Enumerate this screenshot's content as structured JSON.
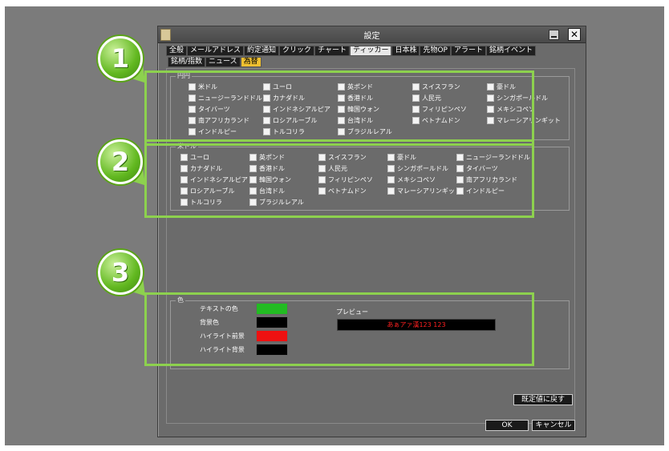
{
  "window": {
    "title": "設定"
  },
  "tabs_main": [
    "全般",
    "メールアドレス",
    "約定通知",
    "クリック",
    "チャート",
    "ティッカー",
    "日本株",
    "先物OP",
    "アラート",
    "銘柄イベント"
  ],
  "tabs_main_active": 5,
  "tabs_sub": [
    "銘柄/指数",
    "ニュース",
    "為替"
  ],
  "tabs_sub_active": 2,
  "group1": {
    "label": "円円",
    "items": [
      "米ドル",
      "ユーロ",
      "英ポンド",
      "スイスフラン",
      "豪ドル",
      "ニュージーランドドル",
      "カナダドル",
      "香港ドル",
      "人民元",
      "シンガポールドル",
      "タイバーツ",
      "インドネシアルピア",
      "韓国ウォン",
      "フィリピンペソ",
      "メキシコペソ",
      "南アフリカランド",
      "ロシアルーブル",
      "台湾ドル",
      "ベトナムドン",
      "マレーシアリンギット",
      "インドルピー",
      "トルコリラ",
      "ブラジルレアル"
    ]
  },
  "group2": {
    "label": "米ドル",
    "items": [
      "ユーロ",
      "英ポンド",
      "スイスフラン",
      "豪ドル",
      "ニュージーランドドル",
      "カナダドル",
      "香港ドル",
      "人民元",
      "シンガポールドル",
      "タイバーツ",
      "インドネシアルピア",
      "韓国ウォン",
      "フィリピンペソ",
      "メキシコペソ",
      "南アフリカランド",
      "ロシアルーブル",
      "台湾ドル",
      "ベトナムドン",
      "マレーシアリンギット",
      "インドルピー",
      "トルコリラ",
      "ブラジルレアル"
    ]
  },
  "color_group": {
    "label": "色",
    "rows": [
      {
        "label": "テキストの色",
        "color": "#22bb22"
      },
      {
        "label": "背景色",
        "color": "#000000"
      },
      {
        "label": "ハイライト前景",
        "color": "#ee1111"
      },
      {
        "label": "ハイライト背景",
        "color": "#000000"
      }
    ],
    "preview_label": "プレビュー",
    "preview_text": "あぁアァ漢123 123"
  },
  "buttons": {
    "reset": "既定値に戻す",
    "ok": "OK",
    "cancel": "キャンセル"
  },
  "callouts": [
    "1",
    "2",
    "3"
  ],
  "colors": {
    "callout": "#8dd14e",
    "window_bg": "#6b6b6b"
  }
}
